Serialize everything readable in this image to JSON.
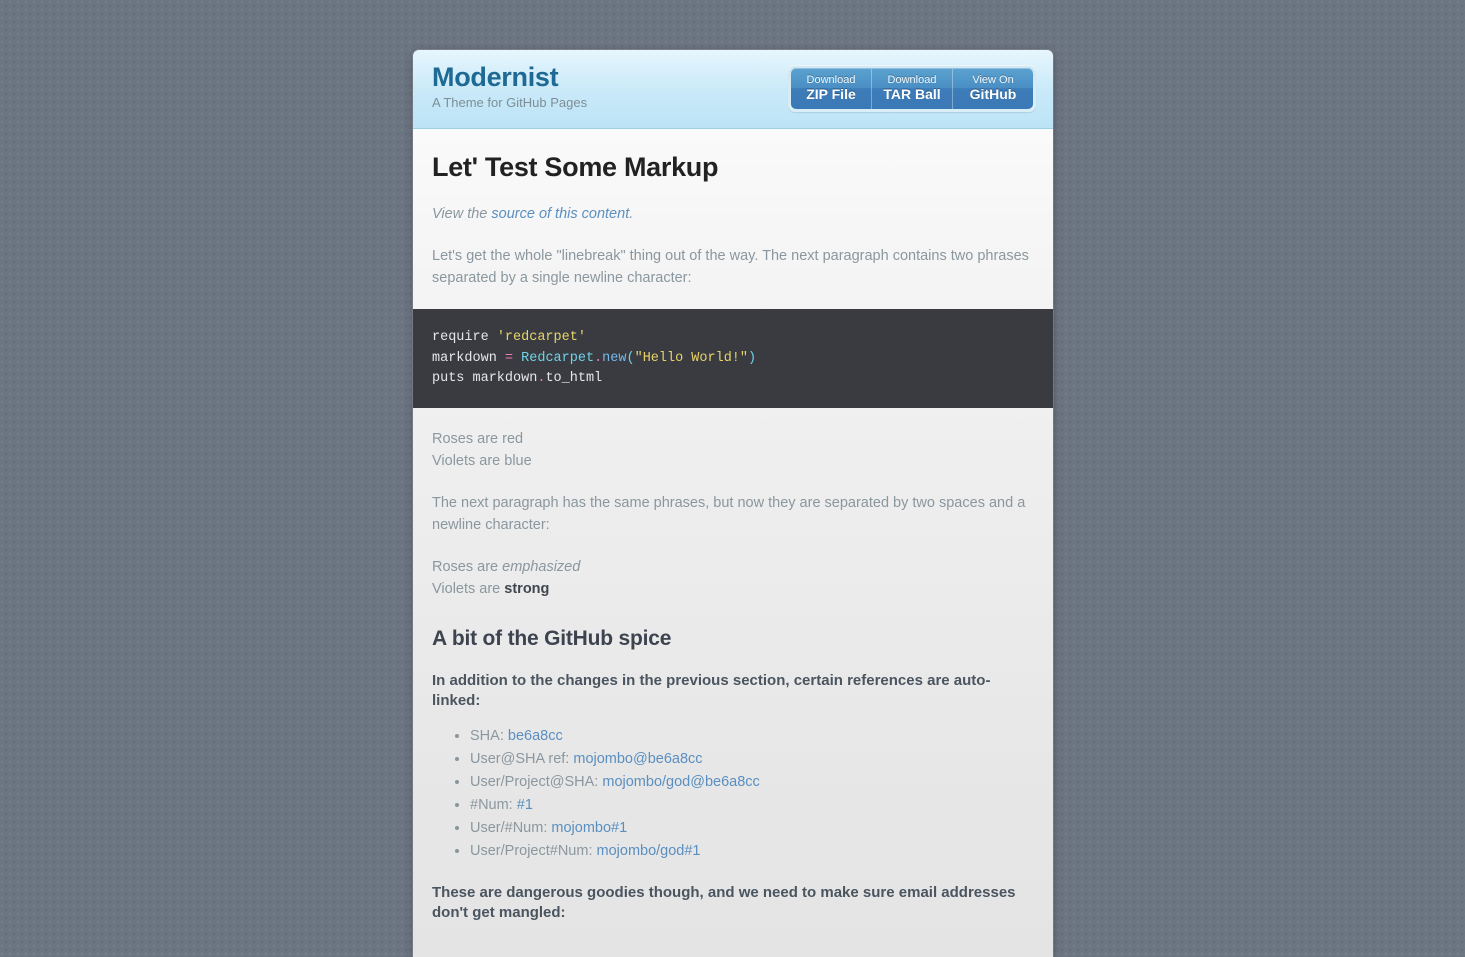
{
  "header": {
    "title": "Modernist",
    "tagline": "A Theme for GitHub Pages",
    "buttons": [
      {
        "top": "Download",
        "bottom": "ZIP File",
        "name": "download-zip-button"
      },
      {
        "top": "Download",
        "bottom": "TAR Ball",
        "name": "download-tar-button"
      },
      {
        "top": "View On",
        "bottom": "GitHub",
        "name": "view-on-github-button"
      }
    ]
  },
  "main": {
    "page_title": "Let' Test Some Markup",
    "source_line": {
      "prefix": "View the ",
      "link": "source of this content",
      "suffix": "."
    },
    "intro_paragraph": "Let's get the whole \"linebreak\" thing out of the way. The next paragraph contains two phrases separated by a single newline character:",
    "code": {
      "language": "ruby",
      "lines": [
        [
          {
            "t": "require ",
            "c": "plain"
          },
          {
            "t": "'redcarpet'",
            "c": "str"
          }
        ],
        [
          {
            "t": "markdown ",
            "c": "plain"
          },
          {
            "t": "=",
            "c": "op"
          },
          {
            "t": " ",
            "c": "plain"
          },
          {
            "t": "Redcarpet",
            "c": "const"
          },
          {
            "t": ".",
            "c": "op"
          },
          {
            "t": "new",
            "c": "fn"
          },
          {
            "t": "(",
            "c": "punc"
          },
          {
            "t": "\"Hello World!\"",
            "c": "str"
          },
          {
            "t": ")",
            "c": "punc"
          }
        ],
        [
          {
            "t": "puts markdown",
            "c": "plain"
          },
          {
            "t": ".",
            "c": "op"
          },
          {
            "t": "to_html",
            "c": "plain"
          }
        ]
      ]
    },
    "poem_one_line_a": "Roses are red",
    "poem_one_line_b": "Violets are blue",
    "two_spaces_paragraph": "The next paragraph has the same phrases, but now they are separated by two spaces and a newline character:",
    "poem_two": {
      "line_a_prefix": "Roses are ",
      "line_a_em": "emphasized",
      "line_b_prefix": "Violets are ",
      "line_b_strong": "strong"
    },
    "spice_heading": "A bit of the GitHub spice",
    "spice_intro": "In addition to the changes in the previous section, certain references are auto-linked:",
    "autolink_items": [
      {
        "label": "SHA: ",
        "link": "be6a8cc"
      },
      {
        "label": "User@SHA ref: ",
        "link": "mojombo@be6a8cc"
      },
      {
        "label": "User/Project@SHA: ",
        "link": "mojombo/god@be6a8cc"
      },
      {
        "label": "#Num: ",
        "link": "#1"
      },
      {
        "label": "User/#Num: ",
        "link": "mojombo#1"
      },
      {
        "label": "User/Project#Num: ",
        "link": "mojombo/god#1"
      }
    ],
    "danger_paragraph": "These are dangerous goodies though, and we need to make sure email addresses don't get mangled:"
  },
  "colors": {
    "page_background": "#6c7582",
    "header_gradient_top": "#e6f6fd",
    "header_gradient_bottom": "#bce4f6",
    "title_blue": "#1f6a94",
    "button_blue": "#4a8ec4",
    "link_blue": "#5a8fc0",
    "body_text": "#8a979e",
    "heading_dark": "#222222",
    "code_background": "#393b41"
  }
}
